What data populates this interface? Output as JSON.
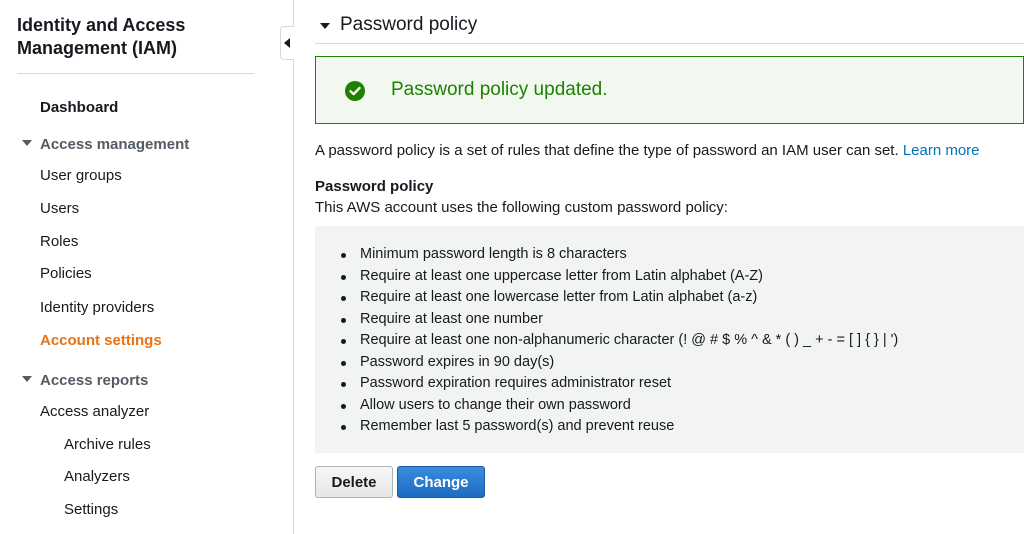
{
  "sidebar": {
    "title": "Identity and Access Management (IAM)",
    "dashboard": "Dashboard",
    "access_management": {
      "label": "Access management",
      "items": [
        "User groups",
        "Users",
        "Roles",
        "Policies",
        "Identity providers",
        "Account settings"
      ]
    },
    "access_reports": {
      "label": "Access reports",
      "items": [
        "Access analyzer",
        "Archive rules",
        "Analyzers",
        "Settings"
      ]
    },
    "active_color": "#ec7211"
  },
  "main": {
    "section_title": "Password policy",
    "alert": {
      "message": "Password policy updated.",
      "color": "#1d8102",
      "icon": "check-circle-icon"
    },
    "description": "A password policy is a set of rules that define the type of password an IAM user can set.",
    "learn_more": "Learn more",
    "policy_heading": "Password policy",
    "policy_subtitle": "This AWS account uses the following custom password policy:",
    "rules": [
      "Minimum password length is 8 characters",
      "Require at least one uppercase letter from Latin alphabet (A-Z)",
      "Require at least one lowercase letter from Latin alphabet (a-z)",
      "Require at least one number",
      "Require at least one non-alphanumeric character (! @ # $ % ^ & * ( ) _ + - = [ ] { } | ')",
      "Password expires in 90 day(s)",
      "Password expiration requires administrator reset",
      "Allow users to change their own password",
      "Remember last 5 password(s) and prevent reuse"
    ],
    "buttons": {
      "delete": "Delete",
      "change": "Change"
    },
    "primary_color": "#0073bb"
  }
}
